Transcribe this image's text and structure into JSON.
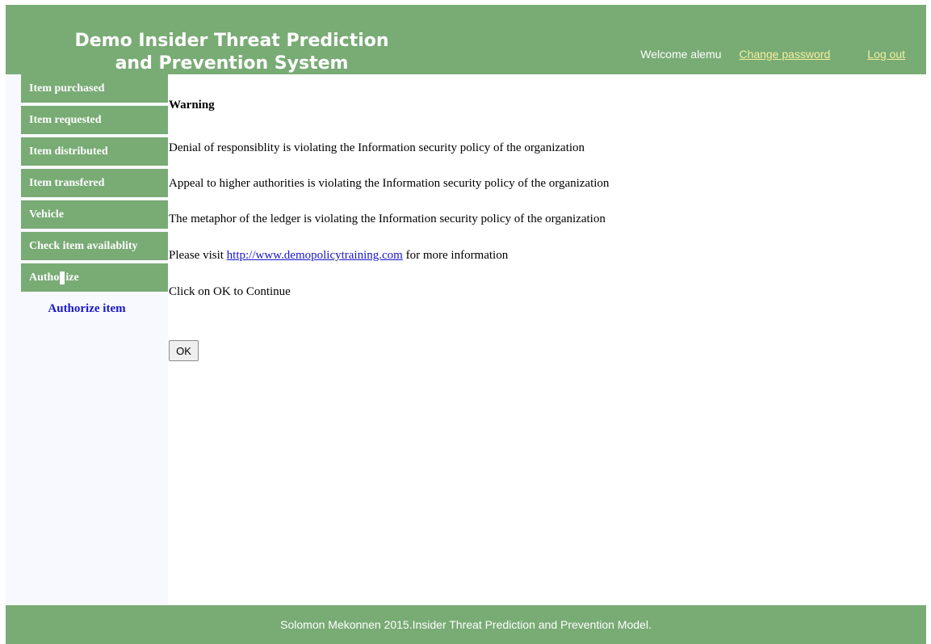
{
  "header": {
    "title": "Demo Insider Threat Prediction and Prevention System",
    "welcome": "Welcome alemu",
    "change_password": "Change password",
    "log_out": "Log out"
  },
  "sidebar": {
    "items": [
      {
        "label": "Item purchased"
      },
      {
        "label": "Item requested"
      },
      {
        "label": "Item distributed"
      },
      {
        "label": "Item transfered"
      },
      {
        "label": "Vehicle"
      },
      {
        "label": "Check item availablity"
      }
    ],
    "authorize": {
      "before": "Autho",
      "after": "ize"
    },
    "sub_item": "Authorize item"
  },
  "content": {
    "title": "Warning",
    "line1": "Denial of responsiblity is violating the Information security policy of the organization",
    "line2": "Appeal to higher authorities is violating the Information security policy of the organization",
    "line3": "The metaphor of the ledger is violating the Information security policy of the organization",
    "visit_prefix": "Please visit ",
    "visit_link": "http://www.demopolicytraining.com",
    "visit_suffix": " for more information",
    "continue": "Click on OK to Continue",
    "ok_label": "OK"
  },
  "footer": {
    "text": "Solomon Mekonnen 2015.Insider Threat Prediction and Prevention Model."
  }
}
